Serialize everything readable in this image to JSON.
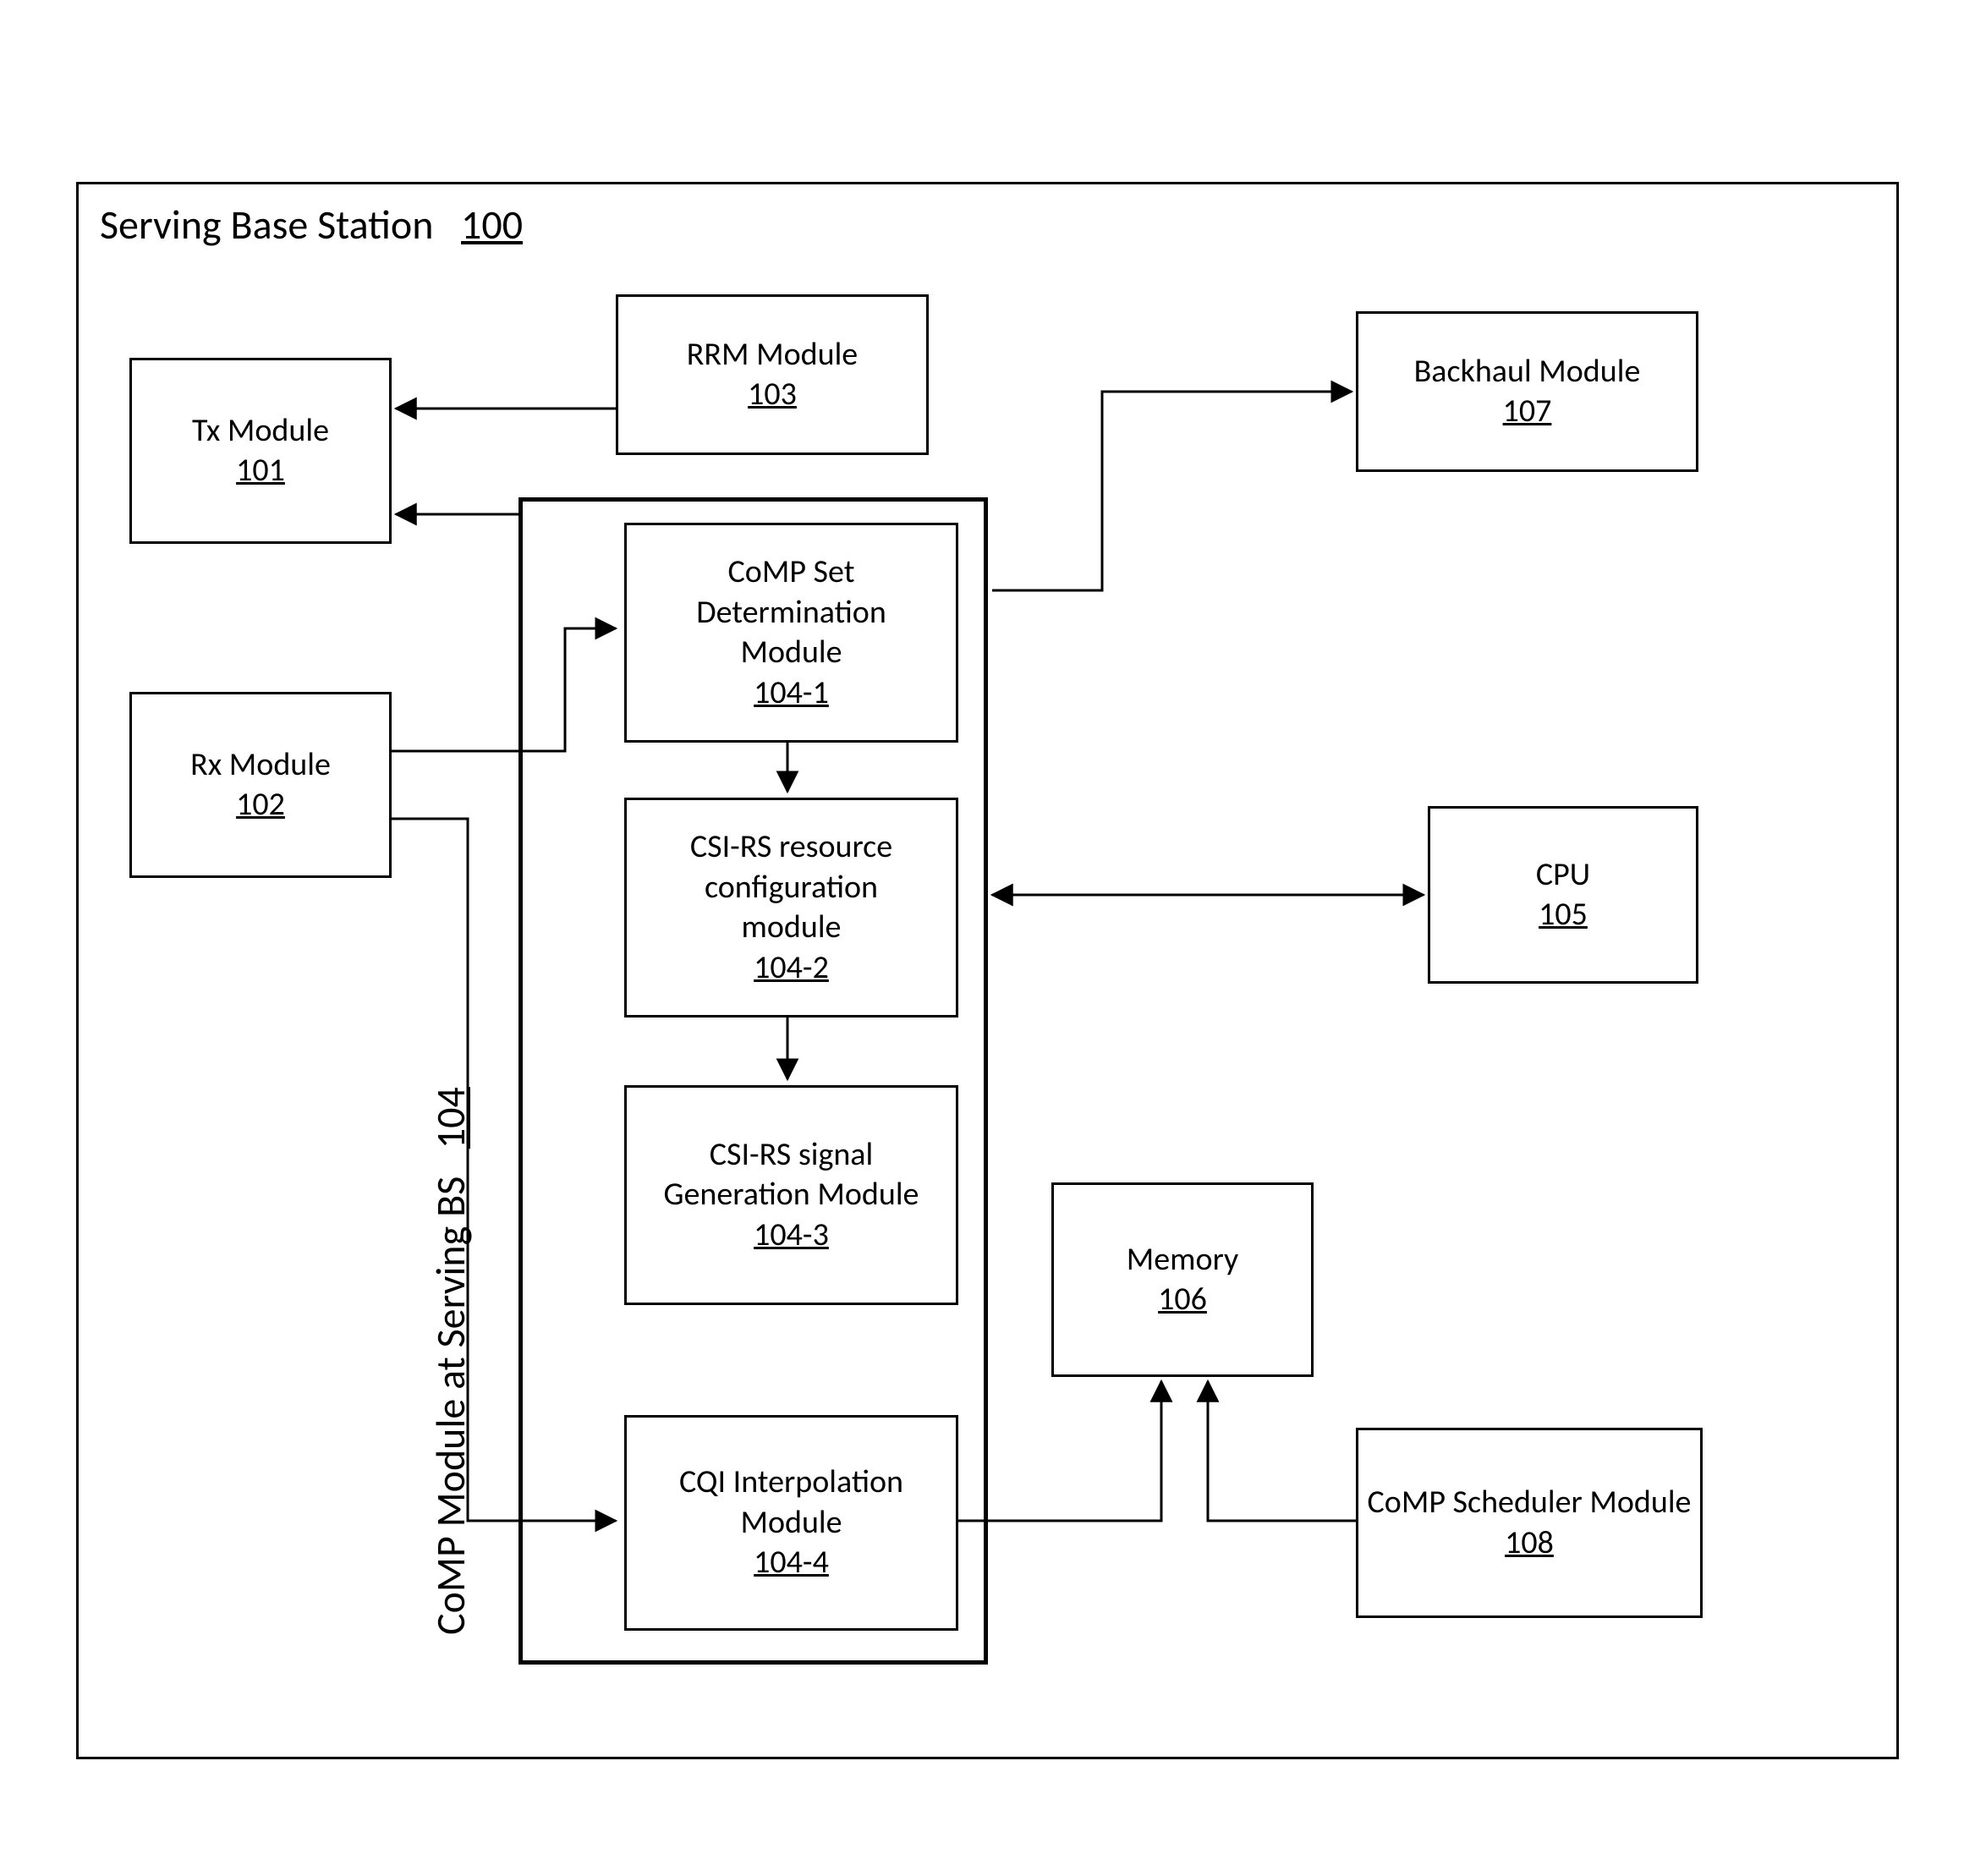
{
  "outer": {
    "title": "Serving Base Station",
    "ref": "100"
  },
  "tx": {
    "title": "Tx Module",
    "ref": "101"
  },
  "rx": {
    "title": "Rx Module",
    "ref": "102"
  },
  "rrm": {
    "title": "RRM Module",
    "ref": "103"
  },
  "comp": {
    "title": "CoMP Module at Serving BS",
    "ref": "104"
  },
  "compSet": {
    "title": "CoMP Set Determination Module",
    "ref": "104-1"
  },
  "csiRes": {
    "title": "CSI-RS resource configuration module",
    "ref": "104-2"
  },
  "csiSig": {
    "title": "CSI-RS signal Generation Module",
    "ref": "104-3"
  },
  "cqi": {
    "title": "CQI Interpolation Module",
    "ref": "104-4"
  },
  "cpu": {
    "title": "CPU",
    "ref": "105"
  },
  "memory": {
    "title": "Memory",
    "ref": "106"
  },
  "backhaul": {
    "title": "Backhaul Module",
    "ref": "107"
  },
  "sched": {
    "title": "CoMP Scheduler Module",
    "ref": "108"
  }
}
